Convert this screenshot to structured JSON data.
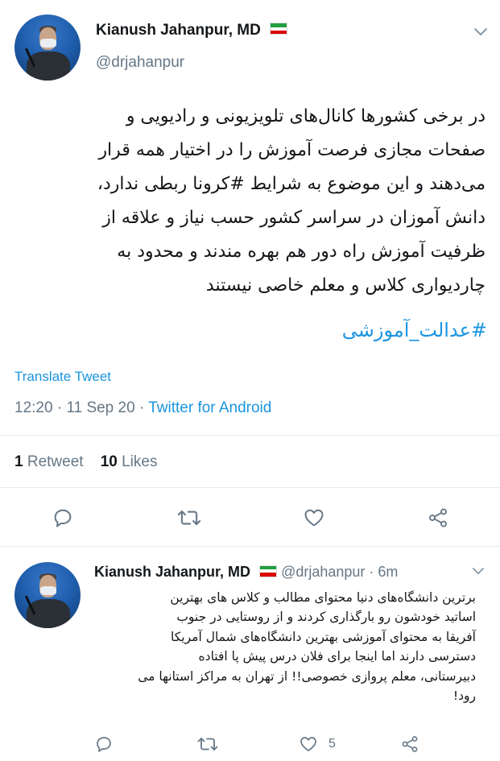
{
  "main_tweet": {
    "author_name": "Kianush Jahanpur, MD",
    "handle": "@drjahanpur",
    "lines": [
      "در برخی کشورها کانال‌های تلویزیونی و  رادیویی و",
      "صفحات مجازی فرصت آموزش را در اختیار همه قرار",
      "می‌دهند و این موضوع به شرایط #کرونا ربطی ندارد،",
      "دانش آموزان در سراسر کشور حسب نیاز و علاقه از",
      "ظرفیت آموزش راه دور هم بهره مندند و محدود به",
      "چاردیواری کلاس و معلم خاصی نیستند"
    ],
    "hashtag": "#عدالت_آموزشی",
    "translate_label": "Translate Tweet",
    "time": "12:20",
    "date": "11 Sep 20",
    "source": "Twitter for Android",
    "retweet_count": "1",
    "retweet_label": "Retweet",
    "like_count": "10",
    "like_label": "Likes"
  },
  "reply_tweet": {
    "author_name": "Kianush Jahanpur, MD",
    "handle": "@drjahanpur",
    "age": "6m",
    "lines": [
      "برترین دانشگاه‌های دنیا محتوای مطالب و کلاس های بهترین",
      "اساتید خودشون رو بارگذاری کردند و از روستایی در جنوب",
      "آفریقا به محتوای آموزشی بهترین دانشگاه‌های شمال آمریکا",
      "دسترسی دارند اما اینجا برای فلان درس پیش پا افتاده",
      "دبیرستانی، معلم پروازی خصوصی!! از تهران به مراکز استانها می",
      "رود!"
    ],
    "like_count": "5"
  },
  "icons": {
    "reply": "reply-icon",
    "retweet": "retweet-icon",
    "like": "heart-icon",
    "share": "share-icon",
    "caret": "chevron-down-icon"
  },
  "colors": {
    "link": "#1b95e0",
    "muted": "#657786",
    "text": "#14171a",
    "divider": "#e6ecf0"
  }
}
